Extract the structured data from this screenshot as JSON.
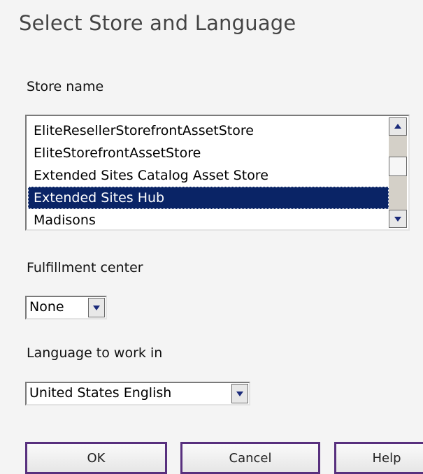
{
  "page": {
    "title": "Select Store and Language"
  },
  "store": {
    "label": "Store name",
    "options": [
      "EliteResellerStorefrontAssetStore",
      "EliteStorefrontAssetStore",
      "Extended Sites Catalog Asset Store",
      "Extended Sites Hub",
      "Madisons"
    ],
    "selected": "Extended Sites Hub"
  },
  "fulfillment": {
    "label": "Fulfillment center",
    "value": "None"
  },
  "language": {
    "label": "Language to work in",
    "value": "United States English"
  },
  "buttons": {
    "ok": "OK",
    "cancel": "Cancel",
    "help": "Help"
  },
  "colors": {
    "selection": "#0a2466",
    "button_border": "#58307e"
  },
  "icons": {
    "scroll_up": "arrow-up-icon",
    "scroll_down": "arrow-down-icon",
    "dropdown": "chevron-down-icon"
  }
}
